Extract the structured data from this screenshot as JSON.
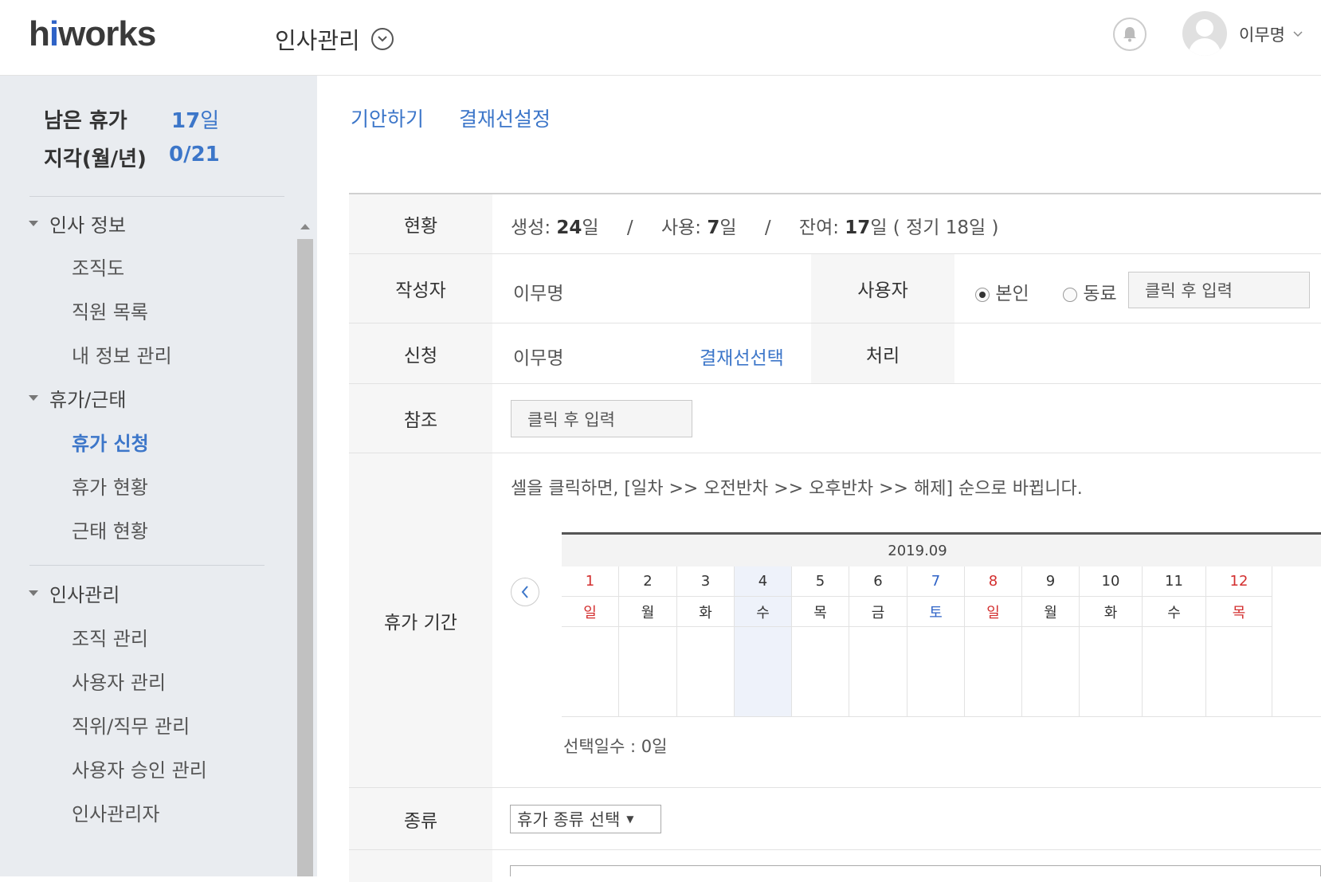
{
  "header": {
    "logo_prefix": "h",
    "logo_i": "i",
    "logo_rest": "works",
    "module_title": "인사관리",
    "user_name": "이무명"
  },
  "sidebar": {
    "leave_label": "남은 휴가",
    "leave_value": "17",
    "leave_unit": "일",
    "late_label": "지각(월/년)",
    "late_value": "0/21",
    "sections": [
      {
        "label": "인사 정보",
        "items": [
          "조직도",
          "직원 목록",
          "내 정보 관리"
        ]
      },
      {
        "label": "휴가/근태",
        "items": [
          "휴가 신청",
          "휴가 현황",
          "근태 현황"
        ]
      },
      {
        "label": "인사관리",
        "items": [
          "조직 관리",
          "사용자 관리",
          "직위/직무 관리",
          "사용자 승인 관리",
          "인사관리자"
        ]
      }
    ],
    "active_item": "휴가 신청"
  },
  "tabs": [
    "기안하기",
    "결재선설정"
  ],
  "form": {
    "status_label": "현황",
    "status": {
      "created_label": "생성: ",
      "created": "24",
      "created_unit": "일",
      "sep": "/",
      "used_label": "사용: ",
      "used": "7",
      "used_unit": "일",
      "remain_label": "잔여: ",
      "remain": "17",
      "remain_unit": "일",
      "regular": "( 정기 18일 )"
    },
    "author_label": "작성자",
    "author": "이무명",
    "user_label": "사용자",
    "radio_self": "본인",
    "radio_colleague": "동료",
    "user_placeholder": "클릭 후 입력",
    "apply_label": "신청",
    "apply_value": "이무명",
    "approval_select": "결재선선택",
    "process_label": "처리",
    "ref_label": "참조",
    "ref_placeholder": "클릭 후 입력",
    "period_label": "휴가 기간",
    "period_hint": "셀을 클릭하면, [일차 >> 오전반차 >> 오후반차 >> 해제] 순으로 바뀝니다.",
    "selected_days": "선택일수 : 0일",
    "type_label": "종류",
    "type_select": "휴가 종류 선택"
  },
  "calendar": {
    "month": "2019.09",
    "days": [
      {
        "d": "1",
        "w": "일",
        "c": "red"
      },
      {
        "d": "2",
        "w": "월",
        "c": ""
      },
      {
        "d": "3",
        "w": "화",
        "c": ""
      },
      {
        "d": "4",
        "w": "수",
        "c": "",
        "sel": true
      },
      {
        "d": "5",
        "w": "목",
        "c": ""
      },
      {
        "d": "6",
        "w": "금",
        "c": ""
      },
      {
        "d": "7",
        "w": "토",
        "c": "blue"
      },
      {
        "d": "8",
        "w": "일",
        "c": "red"
      },
      {
        "d": "9",
        "w": "월",
        "c": ""
      },
      {
        "d": "10",
        "w": "화",
        "c": ""
      },
      {
        "d": "11",
        "w": "수",
        "c": ""
      },
      {
        "d": "12",
        "w": "목",
        "c": "red"
      }
    ]
  }
}
